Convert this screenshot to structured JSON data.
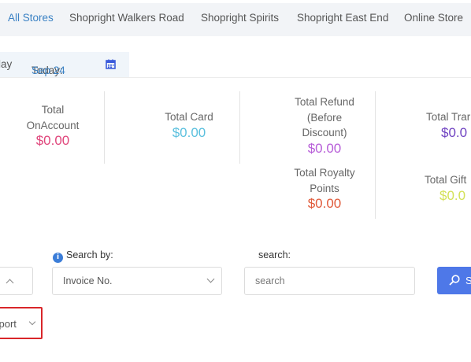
{
  "store_tabs": [
    "All Stores",
    "Shopright Walkers Road",
    "Shopright Spirits",
    "Shopright East End",
    "Online Store"
  ],
  "date_filter": {
    "prev_label": "lay",
    "today_label": "Today:",
    "today_value": "Sep 24"
  },
  "stats": {
    "onaccount": {
      "label_line1": "Total",
      "label_line2": "OnAccount",
      "value": "$0.00"
    },
    "card": {
      "label": "Total Card",
      "value": "$0.00"
    },
    "refund": {
      "label_line1": "Total Refund",
      "label_line2": "(Before",
      "label_line3": "Discount)",
      "value": "$0.00"
    },
    "transfer": {
      "label": "Total Trar",
      "value": "$0.0"
    },
    "royalty": {
      "label_line1": "Total Royalty",
      "label_line2": "Points",
      "value": "$0.00"
    },
    "gift": {
      "label": "Total Gift",
      "value": "$0.0"
    }
  },
  "colors": {
    "onaccount": "#e0457b",
    "card": "#5bc0de",
    "refund": "#b75ed8",
    "transfer": "#6f42c1",
    "royalty": "#e05a3a",
    "gift": "#d4e157"
  },
  "search": {
    "search_by_label": "Search by:",
    "search_by_value": "Invoice No.",
    "search_label": "search:",
    "search_placeholder": "search",
    "button_label": "S"
  },
  "export_label": "kport"
}
